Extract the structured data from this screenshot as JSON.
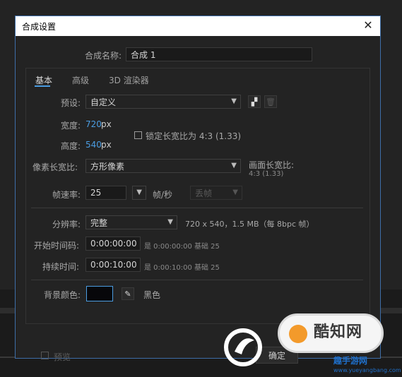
{
  "dialog": {
    "title": "合成设置",
    "close_label": "✕"
  },
  "comp_name": {
    "label": "合成名称:",
    "value": "合成 1"
  },
  "tabs": [
    {
      "label": "基本",
      "active": true
    },
    {
      "label": "高级",
      "active": false
    },
    {
      "label": "3D 渲染器",
      "active": false
    }
  ],
  "preset": {
    "label": "预设:",
    "value": "自定义"
  },
  "width": {
    "label": "宽度:",
    "value": "720",
    "unit": "px"
  },
  "height": {
    "label": "高度:",
    "value": "540",
    "unit": "px"
  },
  "lock_aspect": {
    "label": "锁定长宽比为 4:3 (1.33)",
    "checked": false
  },
  "pixel_aspect": {
    "label": "像素长宽比:",
    "value": "方形像素"
  },
  "frame_aspect": {
    "label": "画面长宽比:",
    "value": "4:3 (1.33)"
  },
  "frame_rate": {
    "label": "帧速率:",
    "value": "25",
    "unit": "帧/秒",
    "dropdown_value": "丢帧"
  },
  "resolution": {
    "label": "分辨率:",
    "value": "完整",
    "info": "720 x 540，1.5 MB（每 8bpc 帧）"
  },
  "start_timecode": {
    "label": "开始时间码:",
    "value": "0:00:00:00",
    "info": "是 0:00:00:00 基础 25"
  },
  "duration": {
    "label": "持续时间:",
    "value": "0:00:10:00",
    "info": "是 0:00:10:00 基础 25"
  },
  "background": {
    "label": "背景颜色:",
    "color_name": "黑色",
    "color": "#07070a"
  },
  "footer": {
    "preview_label": "预览",
    "ok_label": "确定"
  },
  "watermark": {
    "text": "酷知网",
    "site_name": "趣手游网",
    "url": "www.yueyangbang.com"
  },
  "colors": {
    "accent": "#4b9de2",
    "dialog_border": "#3e6ea8"
  }
}
